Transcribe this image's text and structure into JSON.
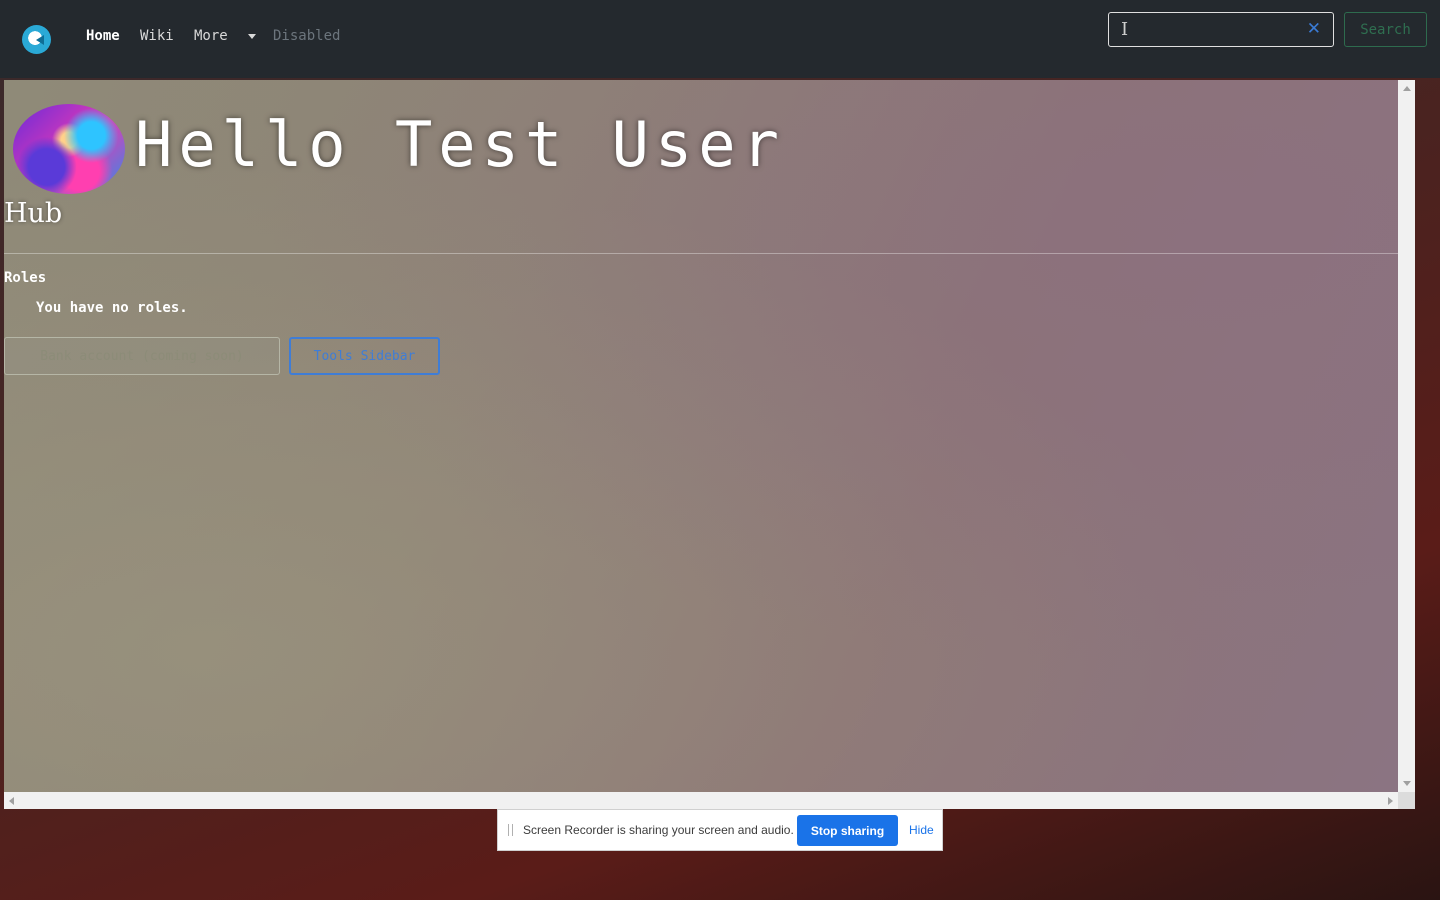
{
  "navbar": {
    "logo_icon": "globe-logo-icon",
    "links": {
      "home": "Home",
      "wiki": "Wiki",
      "more": "More",
      "disabled": "Disabled"
    },
    "search": {
      "placeholder": "",
      "value": "",
      "clear_icon": "✕",
      "button_label": "Search"
    }
  },
  "main": {
    "greeting": "Hello Test User",
    "subtitle": "Hub",
    "roles": {
      "heading": "Roles",
      "empty_text": "You have no roles."
    },
    "buttons": {
      "bank": "Bank account (coming soon)",
      "tools": "Tools Sidebar"
    }
  },
  "share_bar": {
    "message": "Screen Recorder is sharing your screen and audio.",
    "stop_label": "Stop sharing",
    "hide_label": "Hide"
  },
  "colors": {
    "navbar_bg": "#24292e",
    "accent_blue": "#3f7dd6",
    "success_outline": "#2e6b4e",
    "share_button": "#1a73e8"
  }
}
